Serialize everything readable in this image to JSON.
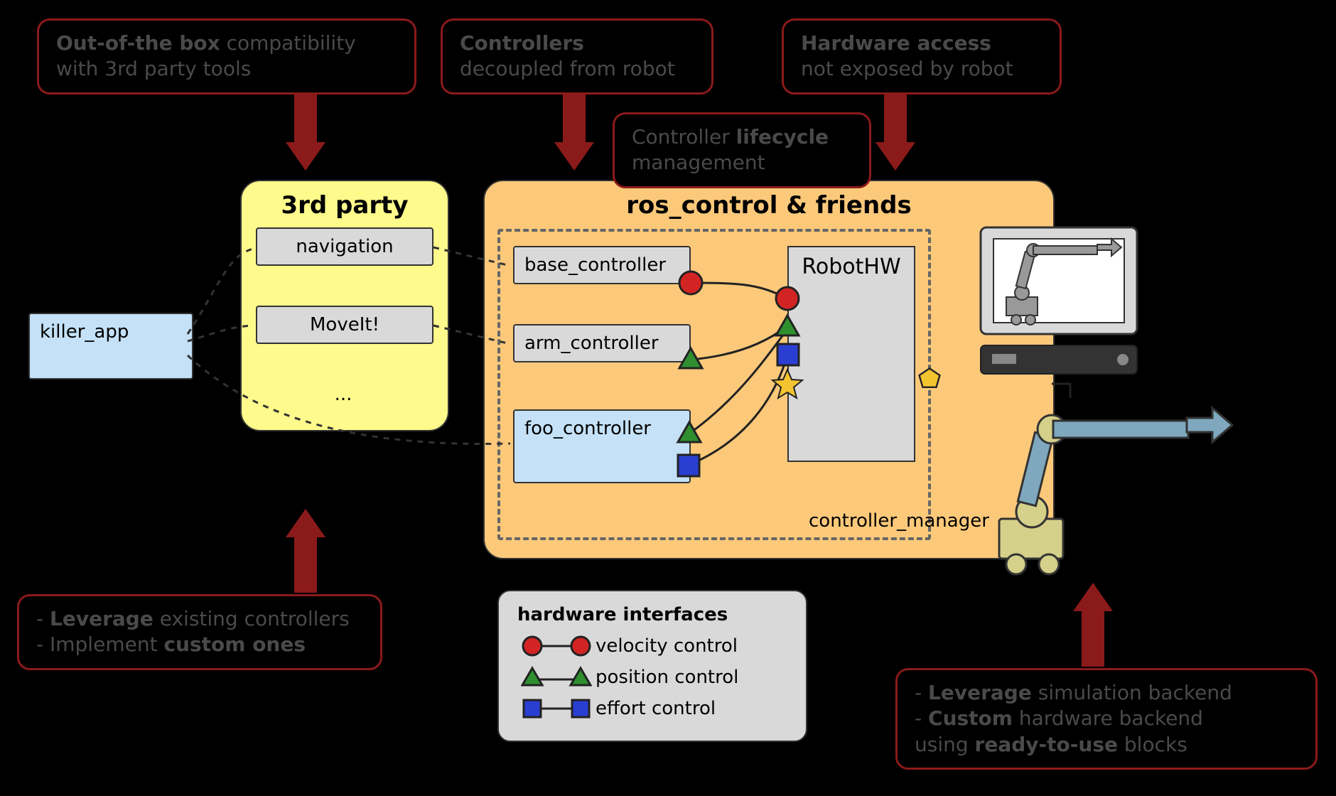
{
  "callouts": {
    "compat": {
      "bold": "Out-of-the box",
      "rest": " compatibility\nwith 3rd party tools"
    },
    "controllers": {
      "bold": "Controllers",
      "rest": "\ndecoupled from robot"
    },
    "hardware": {
      "bold": "Hardware access",
      "rest": "\nnot exposed by robot"
    },
    "lifecycle": {
      "pre": "Controller ",
      "bold": "lifecycle",
      "rest": "\nmanagement"
    },
    "leverage_ctrl": {
      "line1_pre": "- ",
      "line1_bold": "Leverage",
      "line1_rest": " existing controllers",
      "line2_pre": "- Implement ",
      "line2_bold": "custom ones"
    },
    "leverage_sim": {
      "line1_pre": "- ",
      "line1_bold": "Leverage",
      "line1_rest": " simulation backend",
      "line2_pre": "- ",
      "line2_bold": "Custom",
      "line2_rest": " hardware backend",
      "line3_pre": "   using ",
      "line3_bold": "ready-to-use",
      "line3_rest": " blocks"
    }
  },
  "panels": {
    "third_party": "3rd party",
    "ros_control": "ros_control & friends"
  },
  "nodes": {
    "killer_app": "killer_app",
    "navigation": "navigation",
    "moveit": "MoveIt!",
    "ellipsis": "...",
    "base_controller": "base_controller",
    "arm_controller": "arm_controller",
    "foo_controller": "foo_controller",
    "robot_hw": "RobotHW",
    "controller_manager": "controller_manager"
  },
  "legend": {
    "title": "hardware interfaces",
    "velocity": "velocity control",
    "position": "position control",
    "effort": "effort control"
  },
  "colors": {
    "red": "#d32424",
    "green": "#2f8f2f",
    "blue": "#2a3fd1",
    "yellow": "#f4c430",
    "dark": "#222"
  }
}
